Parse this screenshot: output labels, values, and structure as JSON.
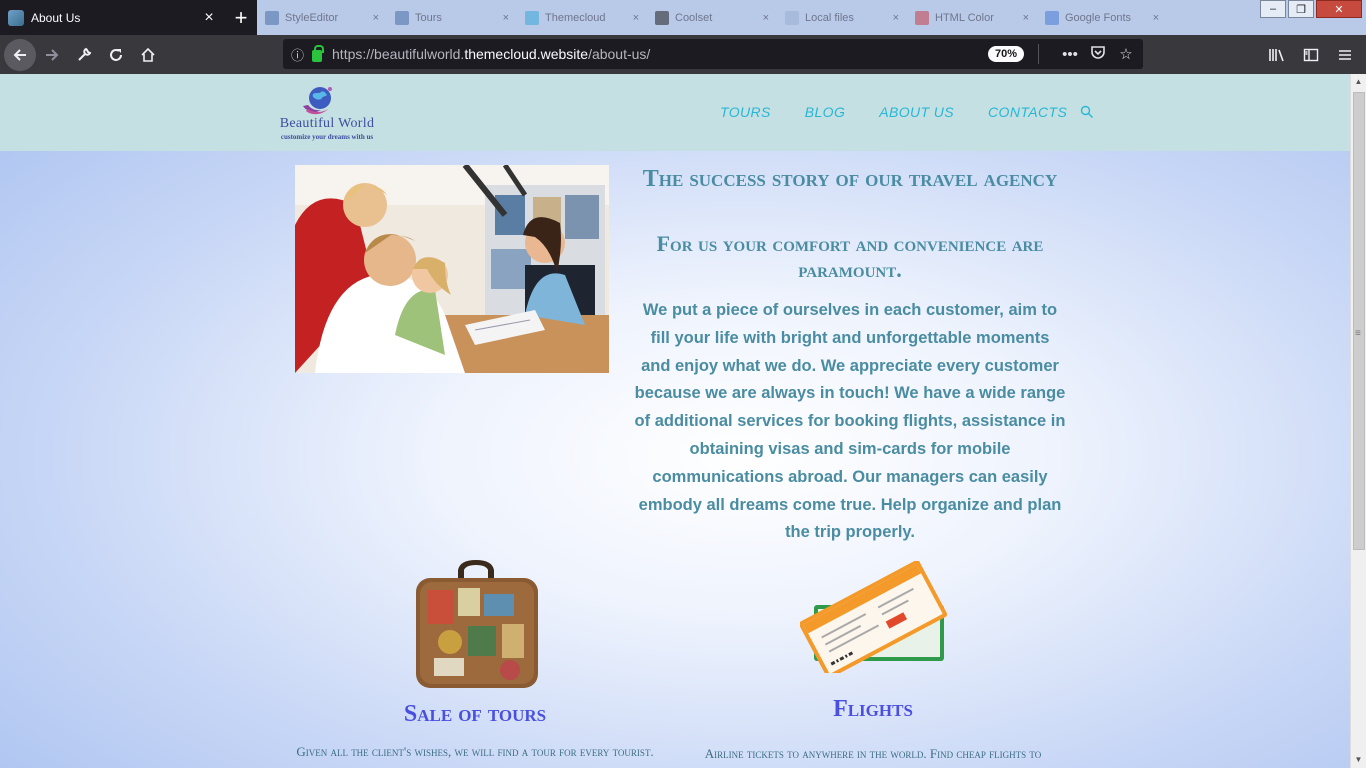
{
  "browser": {
    "active_tab": {
      "title": "About Us",
      "close": "×"
    },
    "new_tab": "+",
    "background_tabs": [
      {
        "title": "StyleEditor",
        "color": "#4a6fa5"
      },
      {
        "title": "Tours",
        "color": "#4a6fa5"
      },
      {
        "title": "Themecloud",
        "color": "#3aa8d8"
      },
      {
        "title": "Coolset",
        "color": "#222222"
      },
      {
        "title": "Local files",
        "color": "#9ab0d4"
      },
      {
        "title": "HTML Color",
        "color": "#c8414a"
      },
      {
        "title": "Google Fonts",
        "color": "#4a7bd6"
      }
    ],
    "window_controls": {
      "minimize": "–",
      "maximize": "❐",
      "close": "✕"
    },
    "url": {
      "prefix": "https://beautifulworld.",
      "domain": "themecloud.website",
      "path": "/about-us/"
    },
    "zoom": "70%",
    "icons": {
      "back": "back-arrow-icon",
      "forward": "forward-arrow-icon",
      "tools": "wrench-icon",
      "reload": "reload-icon",
      "home": "home-icon",
      "info": "info-icon",
      "lock": "lock-icon",
      "more": "ellipsis-icon",
      "pocket": "pocket-icon",
      "star": "star-icon",
      "library": "library-icon",
      "sidebar": "sidebar-icon",
      "menu": "hamburger-icon"
    }
  },
  "site": {
    "logo": {
      "brand": "Beautiful World",
      "tagline": "customize your dreams with us"
    },
    "menu": [
      "TOURS",
      "BLOG",
      "ABOUT US",
      "CONTACTS"
    ],
    "accent": "#29b6d6",
    "heading_color": "#4a8ca2",
    "feature_title_color": "#4a4fe0"
  },
  "content": {
    "title1": "The success story of our travel agency",
    "title2": "For us your comfort and convenience are paramount.",
    "paragraph": "We put a piece of ourselves in each customer, aim to fill your life with bright and unforgettable moments and enjoy what we do. We appreciate every customer because we are always in touch! We have a wide range of additional services for booking flights, assistance in obtaining visas and sim-cards for mobile communications abroad. Our managers can easily embody all dreams come true. Help organize and plan the trip properly.",
    "features": [
      {
        "title": "Sale of tours",
        "text": "Given all the client's wishes, we will find a tour for every tourist."
      },
      {
        "title": "Flights",
        "text": "Airline tickets to anywhere in the world. Find cheap flights to"
      }
    ]
  }
}
